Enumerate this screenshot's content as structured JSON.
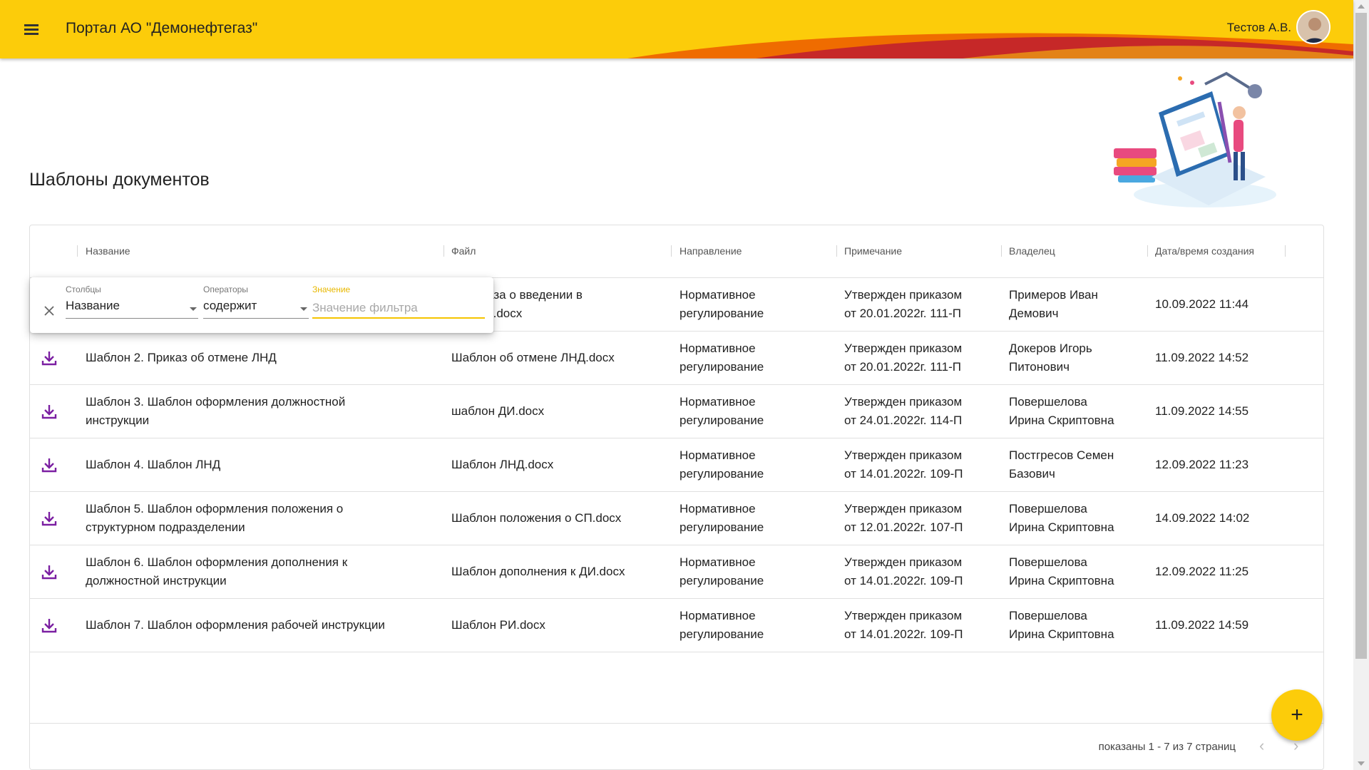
{
  "header": {
    "title": "Портал АО \"Демонефтегаз\"",
    "user_name": "Тестов А.В.",
    "brand_color": "#fccc0a",
    "icons": {
      "menu": "menu-icon",
      "avatar": "user-avatar"
    }
  },
  "page": {
    "title": "Шаблоны документов"
  },
  "grid": {
    "columns": [
      "Название",
      "Файл",
      "Направление",
      "Примечание",
      "Владелец",
      "Дата/время создания"
    ],
    "rows": [
      {
        "name": "",
        "file": "н приказа о введении в ие ЛНД.docx",
        "file_l1": "н приказа о введении в",
        "file_l2": "ие ЛНД.docx",
        "direction_l1": "Нормативное",
        "direction_l2": "регулирование",
        "note_l1": "Утвержден приказом",
        "note_l2": "от 20.01.2022г. 111-П",
        "owner_l1": "Примеров Иван",
        "owner_l2": "Демович",
        "created": "10.09.2022 11:44"
      },
      {
        "name_l1": "Шаблон 2. Приказ об отмене ЛНД",
        "name_l2": "",
        "file_l1": "Шаблон об отмене ЛНД.docx",
        "file_l2": "",
        "direction_l1": "Нормативное",
        "direction_l2": "регулирование",
        "note_l1": "Утвержден приказом",
        "note_l2": "от 20.01.2022г. 111-П",
        "owner_l1": "Докеров Игорь",
        "owner_l2": "Питонович",
        "created": "11.09.2022 14:52"
      },
      {
        "name_l1": "Шаблон 3. Шаблон оформления должностной",
        "name_l2": "инструкции",
        "file_l1": "шаблон ДИ.docx",
        "file_l2": "",
        "direction_l1": "Нормативное",
        "direction_l2": "регулирование",
        "note_l1": "Утвержден приказом",
        "note_l2": "от 24.01.2022г. 114-П",
        "owner_l1": "Повершелова",
        "owner_l2": "Ирина Скриптовна",
        "created": "11.09.2022 14:55"
      },
      {
        "name_l1": "Шаблон 4. Шаблон ЛНД",
        "name_l2": "",
        "file_l1": "Шаблон ЛНД.docx",
        "file_l2": "",
        "direction_l1": "Нормативное",
        "direction_l2": "регулирование",
        "note_l1": "Утвержден приказом",
        "note_l2": "от 14.01.2022г. 109-П",
        "owner_l1": "Постгресов Семен",
        "owner_l2": "Базович",
        "created": "12.09.2022 11:23"
      },
      {
        "name_l1": "Шаблон 5. Шаблон оформления положения о",
        "name_l2": "структурном подразделении",
        "file_l1": "Шаблон положения о СП.docx",
        "file_l2": "",
        "direction_l1": "Нормативное",
        "direction_l2": "регулирование",
        "note_l1": "Утвержден приказом",
        "note_l2": "от 12.01.2022г. 107-П",
        "owner_l1": "Повершелова",
        "owner_l2": "Ирина Скриптовна",
        "created": "14.09.2022 14:02"
      },
      {
        "name_l1": "Шаблон 6. Шаблон оформления дополнения к",
        "name_l2": "должностной инструкции",
        "file_l1": "Шаблон дополнения к ДИ.docx",
        "file_l2": "",
        "direction_l1": "Нормативное",
        "direction_l2": "регулирование",
        "note_l1": "Утвержден приказом",
        "note_l2": "от 14.01.2022г. 109-П",
        "owner_l1": "Повершелова",
        "owner_l2": "Ирина Скриптовна",
        "created": "12.09.2022 11:25"
      },
      {
        "name_l1": "Шаблон 7. Шаблон оформления рабочей инструкции",
        "name_l2": "",
        "file_l1": "Шаблон РИ.docx",
        "file_l2": "",
        "direction_l1": "Нормативное",
        "direction_l2": "регулирование",
        "note_l1": "Утвержден приказом",
        "note_l2": "от 14.01.2022г. 109-П",
        "owner_l1": "Повершелова",
        "owner_l2": "Ирина Скриптовна",
        "created": "11.09.2022 14:59"
      }
    ],
    "row_icon": "download-icon",
    "footer": {
      "pagination_text": "показаны 1 - 7 из 7 страниц",
      "prev_icon": "chevron-left-icon",
      "next_icon": "chevron-right-icon"
    }
  },
  "filter": {
    "columns_label": "Столбцы",
    "columns_value": "Название",
    "operators_label": "Операторы",
    "operators_value": "содержит",
    "value_label": "Значение",
    "value_placeholder": "Значение фильтра",
    "close_icon": "close-icon"
  },
  "fab": {
    "label": "+",
    "icon": "plus-icon"
  },
  "colors": {
    "accent": "#fccc0a",
    "icon_purple": "#7b1fa2",
    "swoosh_red": "#c62828",
    "swoosh_orange": "#ef6c00"
  }
}
